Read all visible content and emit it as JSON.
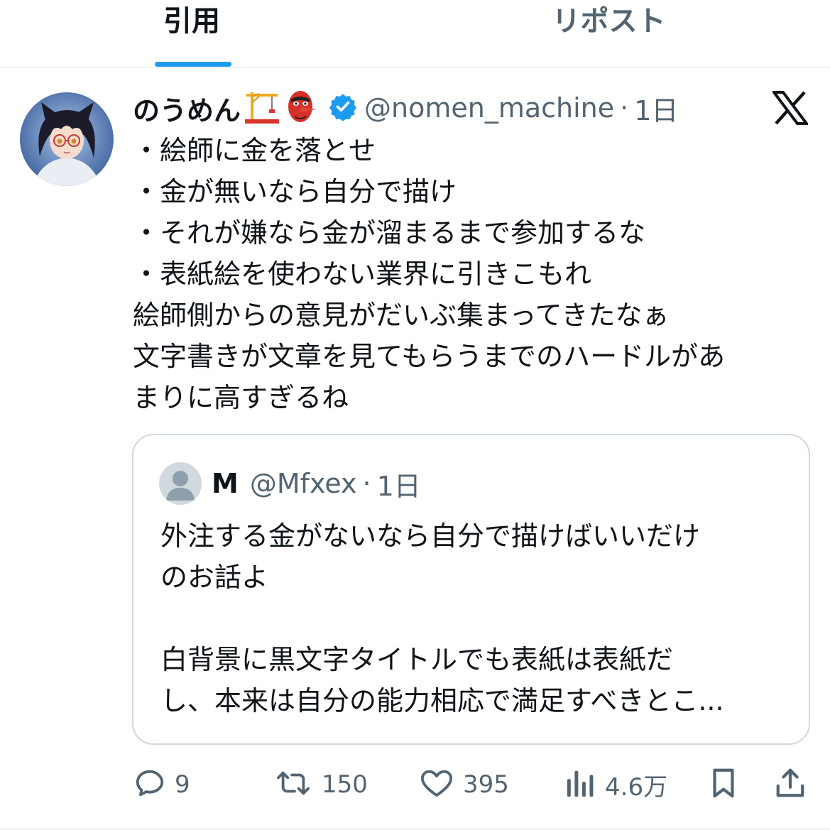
{
  "tabs": [
    {
      "label": "引用",
      "active": true
    },
    {
      "label": "リポスト",
      "active": false
    }
  ],
  "tweet": {
    "display_name": "のうめん",
    "name_emojis": [
      "crane-emoji",
      "tengu-emoji"
    ],
    "verified": true,
    "handle": "@nomen_machine",
    "separator": "·",
    "time": "1日",
    "lines": [
      "・絵師に金を落とせ",
      "・金が無いなら自分で描け",
      "・それが嫌なら金が溜まるまで参加するな",
      "・表紙絵を使わない業界に引きこもれ",
      "絵師側からの意見がだいぶ集まってきたなぁ",
      "文字書きが文章を見てもらうまでのハードルがあ",
      "まりに高すぎるね"
    ]
  },
  "quoted": {
    "display_name": "M",
    "handle": "@Mfxex",
    "separator": "·",
    "time": "1日",
    "lines": [
      "外注する金がないなら自分で描けばいいだけ",
      "のお話よ",
      "",
      "白背景に黒文字タイトルでも表紙は表紙だ",
      "し、本来は自分の能力相応で満足すべきとこ..."
    ]
  },
  "actions": {
    "replies": "9",
    "reposts": "150",
    "likes": "395",
    "views": "4.6万"
  },
  "colors": {
    "accent": "#1d9bf0",
    "text": "#0f1419",
    "secondary": "#536471",
    "border": "#cfd9de"
  }
}
